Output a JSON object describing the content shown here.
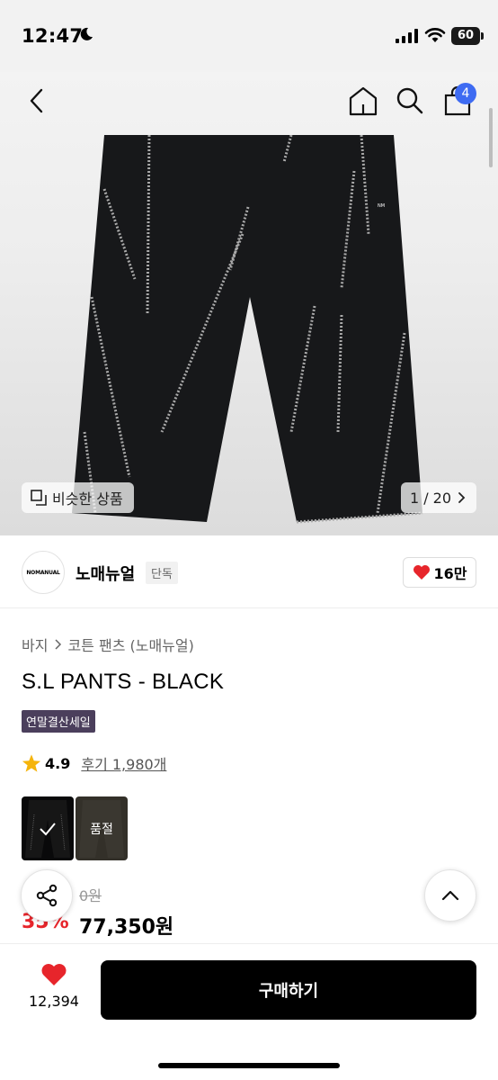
{
  "status_bar": {
    "time": "12:47",
    "battery": "60"
  },
  "header": {
    "cart_count": "4"
  },
  "gallery": {
    "similar_label": "비슷한 상품",
    "page_indicator": "1 / 20"
  },
  "brand": {
    "logo_text": "NOMANUAL",
    "name": "노매뉴얼",
    "exclusive_label": "단독",
    "likes": "16만"
  },
  "product": {
    "breadcrumb": [
      "바지",
      "코튼 팬츠 (노매뉴얼)"
    ],
    "title": "S.L PANTS - BLACK",
    "sale_tag": "연말결산세일",
    "rating": "4.9",
    "reviews_label": "후기 1,980개",
    "options": [
      {
        "color": "#0f0f10",
        "selected": true
      },
      {
        "color": "#4f4a40",
        "sold_out_label": "품절"
      }
    ],
    "original_price": "0원",
    "discount": "35%",
    "price": "77,350원"
  },
  "bottom_bar": {
    "wish_count": "12,394",
    "buy_label": "구매하기"
  },
  "colors": {
    "accent_badge": "#3e6bf2",
    "sale_tag": "#4b3f5c",
    "discount": "#e7252b",
    "heart": "#e7252b"
  },
  "icons": [
    "moon-icon",
    "signal-icon",
    "wifi-icon",
    "back-icon",
    "home-icon",
    "search-icon",
    "bag-icon",
    "similar-icon",
    "chevron-right-icon",
    "heart-icon",
    "star-icon",
    "checkmark-icon",
    "share-icon",
    "chevron-up-icon"
  ]
}
